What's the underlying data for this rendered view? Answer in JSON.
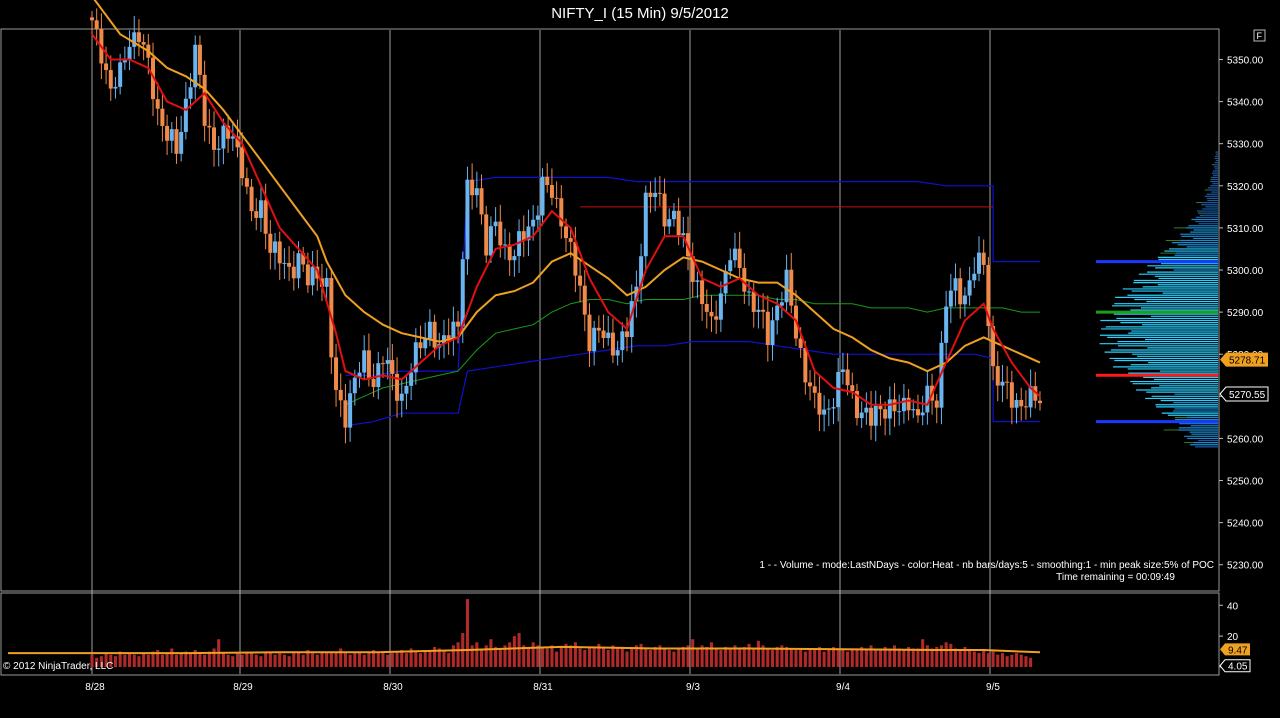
{
  "window": {
    "title": "NIFTY_I (15 Min)  9/5/2012",
    "corner_button": "F"
  },
  "copyright": "© 2012 NinjaTrader, LLC",
  "indicator": {
    "label": "1 -   - Volume - mode:LastNDays  - color:Heat - nb bars/days:5 - smoothing:1 - min peak size:5% of POC",
    "time_remaining": "Time remaining = 00:09:49"
  },
  "colors": {
    "background": "#000000",
    "grid": "#c8c8c8",
    "bull_candle": "#6ab4f0",
    "bear_candle": "#f08a4b",
    "ema_fast": "#e01010",
    "ema_slow": "#f0a020",
    "vwap_green": "#1a9a1a",
    "band_blue": "#1010d0",
    "volume_bar": "#b02a2a",
    "volume_ma": "#f0a020",
    "axis_text": "#ffffff"
  },
  "chart_data": {
    "type": "candlestick",
    "price_axis": {
      "ticks": [
        5350,
        5340,
        5330,
        5320,
        5310,
        5300,
        5290,
        5280,
        5270,
        5260,
        5250,
        5240,
        5230
      ],
      "range": [
        5224,
        5357
      ]
    },
    "dates": [
      "8/28",
      "8/29",
      "8/30",
      "8/31",
      "9/3",
      "9/4",
      "9/5"
    ],
    "price_markers": [
      {
        "label": "5278.71",
        "value": 5278.71,
        "color": "#f0a020"
      },
      {
        "label": "5270.55",
        "value": 5270.55,
        "color": "#ffffff"
      }
    ],
    "volume_axis": {
      "ticks": [
        40,
        20,
        0
      ],
      "range": [
        0,
        46
      ]
    },
    "volume_markers": [
      {
        "label": "9.47",
        "value": 9.47,
        "color": "#f0a020"
      },
      {
        "label": "4.05",
        "value": 4.05,
        "color": "#ffffff"
      }
    ],
    "close_path": [
      [
        0,
        5358
      ],
      [
        2,
        5352
      ],
      [
        4,
        5343
      ],
      [
        6,
        5346
      ],
      [
        8,
        5355
      ],
      [
        10,
        5356
      ],
      [
        12,
        5348
      ],
      [
        14,
        5338
      ],
      [
        16,
        5332
      ],
      [
        18,
        5328
      ],
      [
        20,
        5340
      ],
      [
        22,
        5352
      ],
      [
        24,
        5336
      ],
      [
        26,
        5330
      ],
      [
        28,
        5331
      ],
      [
        30,
        5332
      ],
      [
        32,
        5325
      ],
      [
        34,
        5312
      ],
      [
        36,
        5315
      ],
      [
        38,
        5306
      ],
      [
        40,
        5302
      ],
      [
        42,
        5300
      ],
      [
        44,
        5303
      ],
      [
        46,
        5297
      ],
      [
        48,
        5300
      ],
      [
        50,
        5296
      ],
      [
        51,
        5280
      ],
      [
        52,
        5270
      ],
      [
        54,
        5266
      ],
      [
        56,
        5274
      ],
      [
        58,
        5278
      ],
      [
        60,
        5274
      ],
      [
        62,
        5279
      ],
      [
        64,
        5274
      ],
      [
        66,
        5270
      ],
      [
        68,
        5276
      ],
      [
        70,
        5283
      ],
      [
        72,
        5287
      ],
      [
        74,
        5280
      ],
      [
        76,
        5286
      ],
      [
        78,
        5288
      ],
      [
        80,
        5318
      ],
      [
        82,
        5320
      ],
      [
        84,
        5306
      ],
      [
        86,
        5310
      ],
      [
        88,
        5305
      ],
      [
        90,
        5304
      ],
      [
        92,
        5308
      ],
      [
        94,
        5312
      ],
      [
        96,
        5320
      ],
      [
        98,
        5318
      ],
      [
        100,
        5313
      ],
      [
        102,
        5304
      ],
      [
        104,
        5295
      ],
      [
        106,
        5284
      ],
      [
        108,
        5285
      ],
      [
        110,
        5283
      ],
      [
        112,
        5282
      ],
      [
        114,
        5285
      ],
      [
        116,
        5296
      ],
      [
        118,
        5317
      ],
      [
        120,
        5318
      ],
      [
        122,
        5313
      ],
      [
        124,
        5313
      ],
      [
        126,
        5306
      ],
      [
        128,
        5300
      ],
      [
        130,
        5293
      ],
      [
        132,
        5286
      ],
      [
        134,
        5295
      ],
      [
        136,
        5304
      ],
      [
        138,
        5300
      ],
      [
        140,
        5294
      ],
      [
        142,
        5290
      ],
      [
        144,
        5284
      ],
      [
        146,
        5292
      ],
      [
        148,
        5297
      ],
      [
        150,
        5285
      ],
      [
        152,
        5276
      ],
      [
        154,
        5268
      ],
      [
        156,
        5266
      ],
      [
        158,
        5270
      ],
      [
        160,
        5276
      ],
      [
        162,
        5270
      ],
      [
        164,
        5266
      ],
      [
        166,
        5264
      ],
      [
        168,
        5268
      ],
      [
        170,
        5267
      ],
      [
        172,
        5266
      ],
      [
        174,
        5270
      ],
      [
        176,
        5264
      ],
      [
        178,
        5270
      ],
      [
        180,
        5270
      ],
      [
        182,
        5292
      ],
      [
        184,
        5296
      ],
      [
        186,
        5294
      ],
      [
        188,
        5300
      ],
      [
        190,
        5302
      ],
      [
        192,
        5276
      ],
      [
        194,
        5272
      ],
      [
        196,
        5270
      ],
      [
        198,
        5268
      ],
      [
        200,
        5269
      ],
      [
        202,
        5270
      ]
    ],
    "ema_fast_path": [
      [
        0,
        5356
      ],
      [
        4,
        5350
      ],
      [
        8,
        5350
      ],
      [
        12,
        5348
      ],
      [
        16,
        5340
      ],
      [
        20,
        5338
      ],
      [
        24,
        5342
      ],
      [
        28,
        5335
      ],
      [
        32,
        5330
      ],
      [
        36,
        5320
      ],
      [
        40,
        5310
      ],
      [
        44,
        5305
      ],
      [
        48,
        5300
      ],
      [
        52,
        5285
      ],
      [
        54,
        5276
      ],
      [
        58,
        5274
      ],
      [
        62,
        5275
      ],
      [
        66,
        5274
      ],
      [
        70,
        5278
      ],
      [
        74,
        5282
      ],
      [
        78,
        5284
      ],
      [
        82,
        5296
      ],
      [
        86,
        5305
      ],
      [
        90,
        5306
      ],
      [
        94,
        5308
      ],
      [
        98,
        5314
      ],
      [
        102,
        5310
      ],
      [
        106,
        5298
      ],
      [
        110,
        5290
      ],
      [
        114,
        5286
      ],
      [
        118,
        5300
      ],
      [
        122,
        5308
      ],
      [
        126,
        5308
      ],
      [
        130,
        5298
      ],
      [
        134,
        5296
      ],
      [
        138,
        5298
      ],
      [
        142,
        5294
      ],
      [
        146,
        5292
      ],
      [
        150,
        5288
      ],
      [
        154,
        5276
      ],
      [
        158,
        5272
      ],
      [
        162,
        5271
      ],
      [
        166,
        5268
      ],
      [
        170,
        5268
      ],
      [
        174,
        5269
      ],
      [
        178,
        5268
      ],
      [
        182,
        5278
      ],
      [
        186,
        5288
      ],
      [
        190,
        5292
      ],
      [
        192,
        5286
      ],
      [
        196,
        5278
      ],
      [
        200,
        5272
      ],
      [
        202,
        5270
      ]
    ],
    "ema_slow_path": [
      [
        0,
        5365
      ],
      [
        6,
        5356
      ],
      [
        12,
        5352
      ],
      [
        16,
        5348
      ],
      [
        20,
        5346
      ],
      [
        24,
        5343
      ],
      [
        28,
        5338
      ],
      [
        32,
        5332
      ],
      [
        36,
        5326
      ],
      [
        40,
        5320
      ],
      [
        44,
        5314
      ],
      [
        48,
        5308
      ],
      [
        50,
        5302
      ],
      [
        54,
        5294
      ],
      [
        58,
        5290
      ],
      [
        62,
        5287
      ],
      [
        66,
        5285
      ],
      [
        70,
        5284
      ],
      [
        74,
        5283
      ],
      [
        78,
        5284
      ],
      [
        82,
        5290
      ],
      [
        86,
        5294
      ],
      [
        90,
        5295
      ],
      [
        94,
        5297
      ],
      [
        98,
        5302
      ],
      [
        102,
        5304
      ],
      [
        106,
        5301
      ],
      [
        110,
        5298
      ],
      [
        114,
        5294
      ],
      [
        118,
        5296
      ],
      [
        122,
        5300
      ],
      [
        126,
        5303
      ],
      [
        130,
        5302
      ],
      [
        134,
        5300
      ],
      [
        138,
        5298
      ],
      [
        142,
        5297
      ],
      [
        146,
        5297
      ],
      [
        150,
        5294
      ],
      [
        154,
        5290
      ],
      [
        158,
        5286
      ],
      [
        162,
        5284
      ],
      [
        166,
        5281
      ],
      [
        170,
        5279
      ],
      [
        174,
        5278
      ],
      [
        178,
        5276
      ],
      [
        182,
        5278
      ],
      [
        186,
        5282
      ],
      [
        190,
        5284
      ],
      [
        194,
        5282
      ],
      [
        198,
        5280
      ],
      [
        202,
        5278
      ]
    ],
    "vwap_path": [
      [
        78,
        5276
      ],
      [
        82,
        5281
      ],
      [
        86,
        5285
      ],
      [
        90,
        5286
      ],
      [
        94,
        5287
      ],
      [
        98,
        5290
      ],
      [
        102,
        5292
      ],
      [
        106,
        5293
      ],
      [
        110,
        5293
      ],
      [
        114,
        5292
      ],
      [
        118,
        5293
      ],
      [
        122,
        5293
      ],
      [
        126,
        5293
      ],
      [
        130,
        5294
      ],
      [
        134,
        5294
      ],
      [
        138,
        5294
      ],
      [
        142,
        5294
      ],
      [
        146,
        5293
      ],
      [
        150,
        5293
      ],
      [
        154,
        5292
      ],
      [
        158,
        5292
      ],
      [
        162,
        5292
      ],
      [
        166,
        5291
      ],
      [
        170,
        5291
      ],
      [
        174,
        5291
      ],
      [
        178,
        5290
      ],
      [
        182,
        5291
      ],
      [
        186,
        5291
      ],
      [
        190,
        5291
      ],
      [
        194,
        5291
      ],
      [
        198,
        5290
      ],
      [
        202,
        5290
      ]
    ],
    "vwap_early_path": [
      [
        54,
        5268
      ],
      [
        58,
        5270
      ],
      [
        62,
        5272
      ],
      [
        66,
        5273
      ],
      [
        70,
        5274
      ],
      [
        74,
        5275
      ],
      [
        78,
        5276
      ]
    ],
    "upper_band_path": [
      [
        54,
        5275
      ],
      [
        60,
        5275
      ],
      [
        66,
        5276
      ],
      [
        72,
        5276
      ],
      [
        78,
        5276
      ],
      [
        80,
        5321
      ],
      [
        86,
        5322
      ],
      [
        92,
        5322
      ],
      [
        98,
        5322
      ],
      [
        104,
        5322
      ],
      [
        110,
        5322
      ],
      [
        116,
        5321
      ],
      [
        122,
        5321
      ],
      [
        128,
        5321
      ],
      [
        134,
        5321
      ],
      [
        140,
        5321
      ],
      [
        146,
        5321
      ],
      [
        152,
        5321
      ],
      [
        158,
        5321
      ],
      [
        164,
        5321
      ],
      [
        170,
        5321
      ],
      [
        176,
        5321
      ],
      [
        182,
        5320
      ],
      [
        188,
        5320
      ],
      [
        192,
        5320
      ],
      [
        192,
        5302
      ],
      [
        196,
        5302
      ],
      [
        200,
        5302
      ],
      [
        202,
        5302
      ]
    ],
    "lower_band_path": [
      [
        54,
        5263
      ],
      [
        60,
        5264
      ],
      [
        66,
        5266
      ],
      [
        72,
        5266
      ],
      [
        78,
        5266
      ],
      [
        80,
        5276
      ],
      [
        86,
        5277
      ],
      [
        92,
        5278
      ],
      [
        98,
        5279
      ],
      [
        104,
        5280
      ],
      [
        110,
        5281
      ],
      [
        116,
        5282
      ],
      [
        122,
        5282
      ],
      [
        128,
        5283
      ],
      [
        134,
        5283
      ],
      [
        140,
        5283
      ],
      [
        146,
        5282
      ],
      [
        152,
        5281
      ],
      [
        158,
        5280
      ],
      [
        164,
        5280
      ],
      [
        170,
        5280
      ],
      [
        176,
        5280
      ],
      [
        182,
        5280
      ],
      [
        188,
        5280
      ],
      [
        192,
        5279
      ],
      [
        192,
        5264
      ],
      [
        196,
        5264
      ],
      [
        202,
        5264
      ]
    ],
    "red_level": {
      "value": 5315,
      "from": 104,
      "to": 192
    },
    "profile_levels": [
      {
        "value": 5302,
        "color": "#1a3aff"
      },
      {
        "value": 5290,
        "color": "#1aa01a"
      },
      {
        "value": 5275,
        "color": "#ff1a1a"
      },
      {
        "value": 5264,
        "color": "#1a3aff"
      }
    ],
    "volume_values": [
      8,
      6,
      7,
      9,
      8,
      7,
      10,
      8,
      9,
      8,
      7,
      9,
      8,
      10,
      11,
      8,
      9,
      12,
      8,
      9,
      10,
      9,
      11,
      9,
      8,
      10,
      12,
      18,
      9,
      8,
      7,
      9,
      8,
      10,
      9,
      8,
      7,
      9,
      10,
      8,
      9,
      8,
      7,
      9,
      10,
      8,
      11,
      9,
      8,
      9,
      10,
      9,
      10,
      12,
      9,
      8,
      9,
      10,
      8,
      9,
      11,
      10,
      9,
      8,
      9,
      10,
      11,
      9,
      12,
      10,
      9,
      11,
      10,
      13,
      12,
      11,
      9,
      14,
      16,
      22,
      44,
      14,
      16,
      12,
      14,
      18,
      13,
      12,
      14,
      16,
      20,
      22,
      14,
      12,
      16,
      14,
      13,
      12,
      14,
      10,
      13,
      15,
      14,
      16,
      12,
      11,
      13,
      12,
      15,
      12,
      11,
      14,
      12,
      13,
      10,
      12,
      14,
      15,
      12,
      11,
      13,
      14,
      12,
      11,
      10,
      12,
      13,
      14,
      18,
      12,
      14,
      13,
      16,
      12,
      11,
      13,
      12,
      14,
      12,
      13,
      15,
      12,
      17,
      14,
      12,
      11,
      13,
      14,
      13,
      12,
      11,
      12,
      10,
      11,
      12,
      13,
      10,
      11,
      13,
      12,
      11,
      10,
      12,
      11,
      13,
      12,
      14,
      11,
      12,
      13,
      12,
      14,
      12,
      11,
      13,
      12,
      12,
      18,
      14,
      12,
      13,
      14,
      16,
      15,
      12,
      11,
      13,
      11,
      10,
      9,
      11,
      9,
      10,
      8,
      9,
      7,
      8,
      9,
      8,
      7,
      6
    ],
    "volume_ma_path": [
      [
        0,
        9
      ],
      [
        20,
        9
      ],
      [
        40,
        9.5
      ],
      [
        60,
        9.5
      ],
      [
        80,
        11
      ],
      [
        100,
        13
      ],
      [
        120,
        12
      ],
      [
        140,
        12
      ],
      [
        160,
        11.5
      ],
      [
        180,
        11
      ],
      [
        190,
        11
      ],
      [
        202,
        9.5
      ]
    ]
  }
}
